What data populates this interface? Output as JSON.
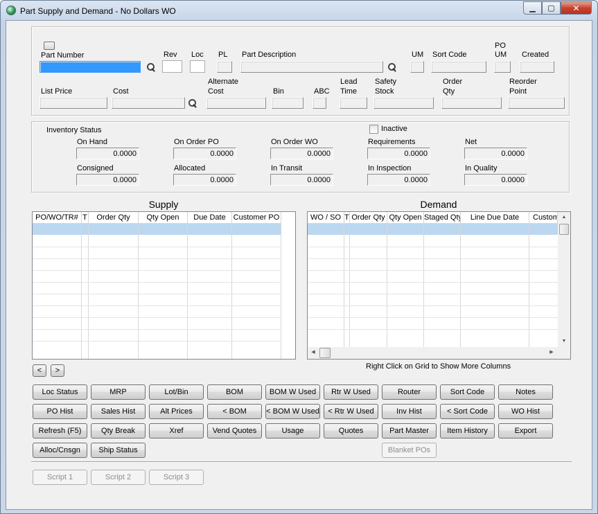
{
  "window": {
    "title": "Part Supply and Demand - No Dollars WO",
    "min_glyph": "▁",
    "max_glyph": "▢",
    "close_glyph": "✕"
  },
  "part": {
    "labels": {
      "part_number": "Part Number",
      "rev": "Rev",
      "loc": "Loc",
      "pl": "PL",
      "description": "Part Description",
      "um": "UM",
      "sort_code": "Sort Code",
      "po_um_1": "PO",
      "po_um_2": "UM",
      "created": "Created",
      "list_price": "List Price",
      "cost": "Cost",
      "alt_cost_1": "Alternate",
      "alt_cost_2": "Cost",
      "bin": "Bin",
      "abc": "ABC",
      "lead_1": "Lead",
      "lead_2": "Time",
      "safety_1": "Safety",
      "safety_2": "Stock",
      "order_1": "Order",
      "order_2": "Qty",
      "reorder_1": "Reorder",
      "reorder_2": "Point"
    },
    "values": {
      "part_number": "",
      "rev": "",
      "loc": "",
      "pl": "",
      "description": "",
      "um": "",
      "sort_code": "",
      "po_um": "",
      "created": "",
      "list_price": "",
      "cost": "",
      "alt_cost": "",
      "bin": "",
      "abc": "",
      "lead_time": "",
      "safety_stock": "",
      "order_qty": "",
      "reorder_point": ""
    }
  },
  "inventory": {
    "title": "Inventory Status",
    "inactive_label": "Inactive",
    "inactive_checked": false,
    "fields": [
      {
        "label": "On Hand",
        "value": "0.0000"
      },
      {
        "label": "On Order PO",
        "value": "0.0000"
      },
      {
        "label": "On Order WO",
        "value": "0.0000"
      },
      {
        "label": "Requirements",
        "value": "0.0000"
      },
      {
        "label": "Net",
        "value": "0.0000"
      },
      {
        "label": "Consigned",
        "value": "0.0000"
      },
      {
        "label": "Allocated",
        "value": "0.0000"
      },
      {
        "label": "In Transit",
        "value": "0.0000"
      },
      {
        "label": "In Inspection",
        "value": "0.0000"
      },
      {
        "label": "In Quality",
        "value": "0.0000"
      }
    ]
  },
  "supply": {
    "title": "Supply",
    "columns": [
      "PO/WO/TR#",
      "T",
      "Order Qty",
      "Qty Open",
      "Due Date",
      "Customer PO"
    ],
    "rows": []
  },
  "demand": {
    "title": "Demand",
    "columns": [
      "WO / SO",
      "T",
      "Order Qty",
      "Qty Open",
      "Staged Qty",
      "Line Due Date",
      "Customer"
    ],
    "rows": [],
    "hint": "Right Click on Grid to Show More Columns"
  },
  "nav": {
    "prev": "<",
    "next": ">"
  },
  "buttons": {
    "row1": [
      "Loc Status",
      "MRP",
      "Lot/Bin",
      "BOM",
      "BOM W Used",
      "Rtr W Used",
      "Router",
      "Sort Code",
      "Notes"
    ],
    "row2": [
      "PO Hist",
      "Sales Hist",
      "Alt Prices",
      "< BOM",
      "< BOM W Used",
      "< Rtr W Used",
      "Inv Hist",
      "< Sort Code",
      "WO Hist"
    ],
    "row3": [
      "Refresh (F5)",
      "Qty Break",
      "Xref",
      "Vend Quotes",
      "Usage",
      "Quotes",
      "Part Master",
      "Item History",
      "Export"
    ],
    "row4": [
      "Alloc/Cnsgn",
      "Ship Status"
    ],
    "blanket": "Blanket POs",
    "scripts": [
      "Script 1",
      "Script 2",
      "Script 3"
    ]
  }
}
